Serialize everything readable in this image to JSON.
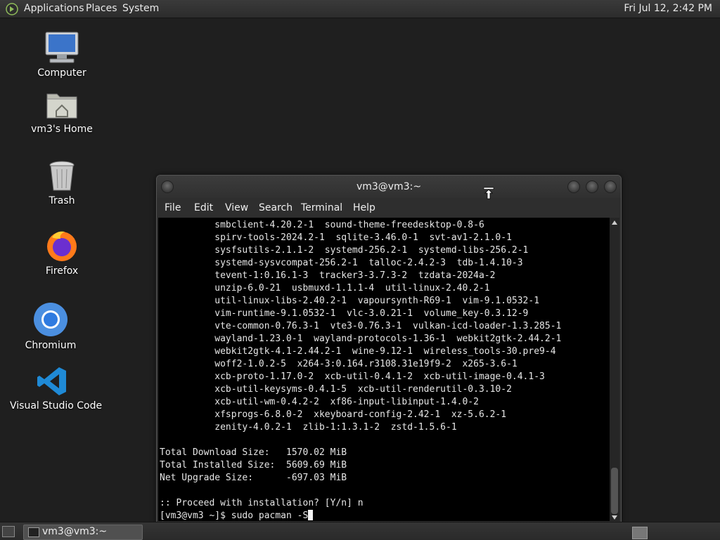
{
  "top_panel": {
    "menus": [
      "Applications",
      "Places",
      "System"
    ],
    "clock": "Fri Jul 12,  2:42 PM"
  },
  "desktop_icons": [
    {
      "label": "Computer",
      "icon": "computer-icon"
    },
    {
      "label": "vm3's Home",
      "icon": "home-folder-icon"
    },
    {
      "label": "Trash",
      "icon": "trash-icon"
    },
    {
      "label": "Firefox",
      "icon": "firefox-icon"
    },
    {
      "label": "Chromium",
      "icon": "chromium-icon"
    },
    {
      "label": "Visual Studio Code",
      "icon": "vscode-icon"
    }
  ],
  "terminal": {
    "title": "vm3@vm3:~",
    "menu": [
      "File",
      "Edit",
      "View",
      "Search",
      "Terminal",
      "Help"
    ],
    "lines": [
      "          smbclient-4.20.2-1  sound-theme-freedesktop-0.8-6",
      "          spirv-tools-2024.2-1  sqlite-3.46.0-1  svt-av1-2.1.0-1",
      "          sysfsutils-2.1.1-2  systemd-256.2-1  systemd-libs-256.2-1",
      "          systemd-sysvcompat-256.2-1  talloc-2.4.2-3  tdb-1.4.10-3",
      "          tevent-1:0.16.1-3  tracker3-3.7.3-2  tzdata-2024a-2",
      "          unzip-6.0-21  usbmuxd-1.1.1-4  util-linux-2.40.2-1",
      "          util-linux-libs-2.40.2-1  vapoursynth-R69-1  vim-9.1.0532-1",
      "          vim-runtime-9.1.0532-1  vlc-3.0.21-1  volume_key-0.3.12-9",
      "          vte-common-0.76.3-1  vte3-0.76.3-1  vulkan-icd-loader-1.3.285-1",
      "          wayland-1.23.0-1  wayland-protocols-1.36-1  webkit2gtk-2.44.2-1",
      "          webkit2gtk-4.1-2.44.2-1  wine-9.12-1  wireless_tools-30.pre9-4",
      "          woff2-1.0.2-5  x264-3:0.164.r3108.31e19f9-2  x265-3.6-1",
      "          xcb-proto-1.17.0-2  xcb-util-0.4.1-2  xcb-util-image-0.4.1-3",
      "          xcb-util-keysyms-0.4.1-5  xcb-util-renderutil-0.3.10-2",
      "          xcb-util-wm-0.4.2-2  xf86-input-libinput-1.4.0-2",
      "          xfsprogs-6.8.0-2  xkeyboard-config-2.42-1  xz-5.6.2-1",
      "          zenity-4.0.2-1  zlib-1:1.3.1-2  zstd-1.5.6-1",
      "",
      "Total Download Size:   1570.02 MiB",
      "Total Installed Size:  5609.69 MiB",
      "Net Upgrade Size:      -697.03 MiB",
      "",
      ":: Proceed with installation? [Y/n] n"
    ],
    "prompt": "[vm3@vm3 ~]$ sudo pacman -S"
  },
  "taskbar": {
    "task_label": "vm3@vm3:~"
  },
  "colors": {
    "desktop": "#1f1f1f",
    "terminal_bg": "#000000",
    "terminal_fg": "#e6e6e6"
  }
}
